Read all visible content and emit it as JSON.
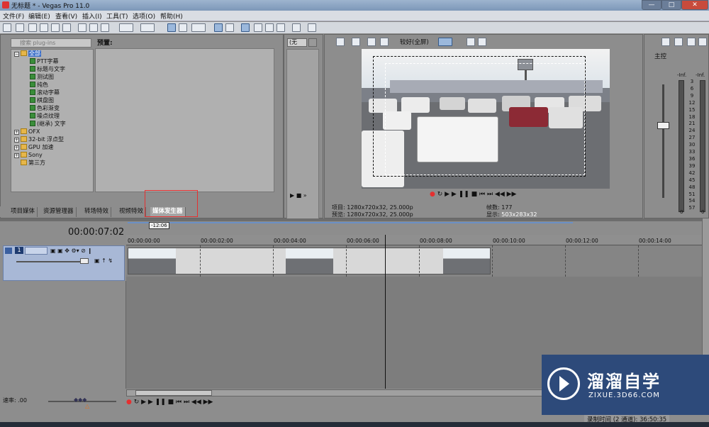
{
  "window": {
    "title": "无标题 * - Vegas Pro 11.0",
    "min": "—",
    "max": "□",
    "close": "✕"
  },
  "menu": [
    "文件(F)",
    "编辑(E)",
    "查看(V)",
    "插入(I)",
    "工具(T)",
    "选项(O)",
    "帮助(H)"
  ],
  "toolbar_icons": [
    "new-icon",
    "open-icon",
    "save-icon",
    "saveas-icon",
    "render-icon",
    "properties-icon",
    "cut-icon",
    "copy-icon",
    "paste-icon",
    "undo-icon",
    "redo-icon",
    "edit-tool-icon",
    "envelope-tool-icon",
    "selection-tool-icon",
    "zoom-tool-icon",
    "snap-icon",
    "autoripple-icon",
    "lock-envelope-icon",
    "ignore-grouping-icon",
    "auto-crossfade-icon",
    "help-icon"
  ],
  "plugins": {
    "search_placeholder": "搜索 plug-ins",
    "tree": [
      {
        "label": "全部",
        "type": "folder",
        "expanded": true,
        "selected": true,
        "level": 0
      },
      {
        "label": "PTT字幕",
        "type": "plugin",
        "level": 1
      },
      {
        "label": "标题与文字",
        "type": "plugin",
        "level": 1
      },
      {
        "label": "测试图",
        "type": "plugin",
        "level": 1
      },
      {
        "label": "纯色",
        "type": "plugin",
        "level": 1
      },
      {
        "label": "滚动字幕",
        "type": "plugin",
        "level": 1
      },
      {
        "label": "棋盘图",
        "type": "plugin",
        "level": 1
      },
      {
        "label": "色彩渐变",
        "type": "plugin",
        "level": 1
      },
      {
        "label": "噪点纹理",
        "type": "plugin",
        "level": 1
      },
      {
        "label": "(继承) 文字",
        "type": "plugin",
        "level": 1
      },
      {
        "label": "OFX",
        "type": "folder",
        "level": 0
      },
      {
        "label": "32-bit 浮点型",
        "type": "folder",
        "level": 0
      },
      {
        "label": "GPU 加速",
        "type": "folder",
        "level": 0
      },
      {
        "label": "Sony",
        "type": "folder",
        "level": 0
      },
      {
        "label": "第三方",
        "type": "folder",
        "level": 0,
        "noexp": true
      }
    ],
    "preset_label": "预置:"
  },
  "left_tabs": [
    "项目媒体",
    "资源管理器",
    "转场特效",
    "视频特效",
    "媒体发生器"
  ],
  "trimmer": {
    "select": "(无"
  },
  "preview": {
    "quality": "较好(全屏)",
    "project_label": "项目:",
    "project_value": "1280x720x32, 25.000p",
    "preview_label": "预览:",
    "preview_value": "1280x720x32, 25.000p",
    "frame_label": "帧数:",
    "frame_value": "177",
    "display_label": "显示:",
    "display_value": "503x283x32"
  },
  "master": {
    "label": "主控",
    "inf_left": "-Inf.",
    "inf_right": "-Inf.",
    "scale": [
      "3",
      "6",
      "9",
      "12",
      "15",
      "18",
      "21",
      "24",
      "27",
      "30",
      "33",
      "36",
      "39",
      "42",
      "45",
      "48",
      "51",
      "54",
      "57"
    ],
    "bottom_left": "0",
    "bottom_right": "0"
  },
  "timeline": {
    "timecode": "00:00:07:02",
    "region_marker": "-12:06",
    "ticks": [
      "00:00:00:00",
      "00:00:02:00",
      "00:00:04:00",
      "00:00:06:00",
      "00:00:08:00",
      "00:00:10:00",
      "00:00:12:00",
      "00:00:14:00"
    ],
    "track_number": "1",
    "rate_label": "速率: .00",
    "record_time": "录制时间 (2 通道): 36:50:35"
  },
  "watermark": {
    "title": "溜溜自学",
    "url": "ZIXUE.3D66.COM"
  },
  "colors": {
    "accent": "#9bb8dc",
    "track": "#a8b8d6",
    "red": "#e53030"
  }
}
